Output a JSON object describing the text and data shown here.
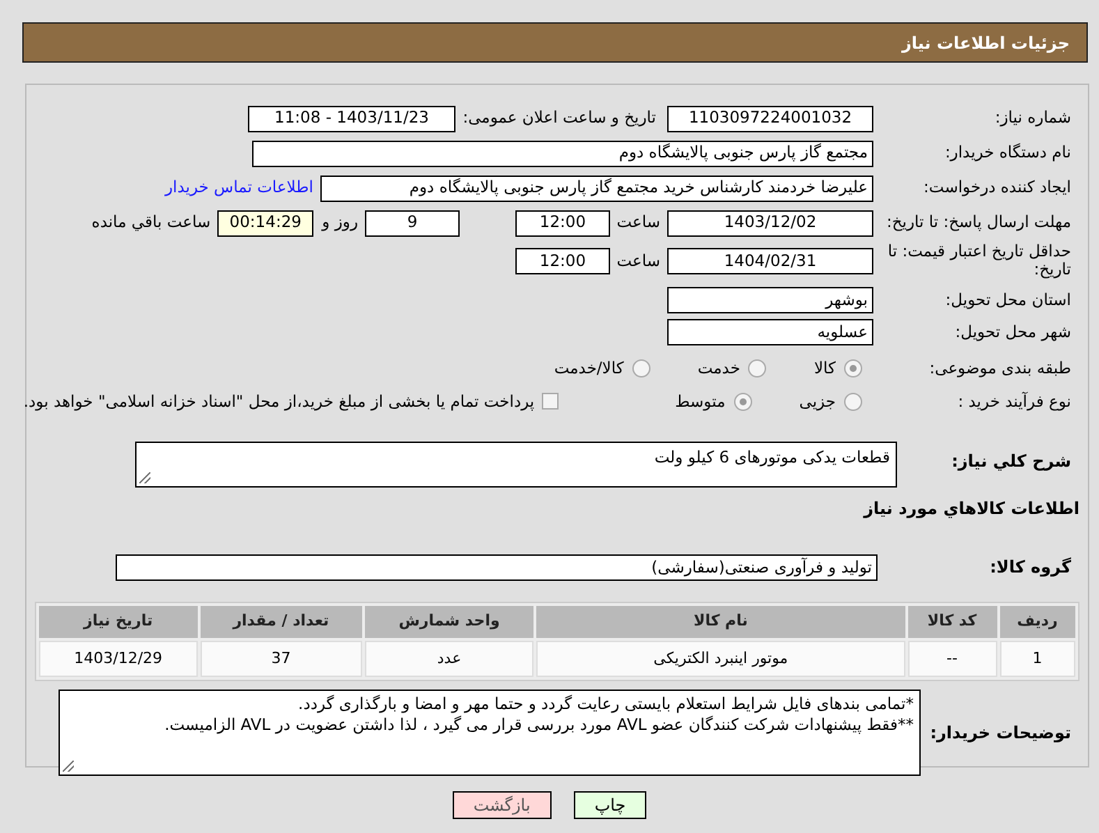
{
  "header": {
    "title": "جزئیات اطلاعات نیاز"
  },
  "need_number": {
    "label": "شماره نیاز:",
    "value": "1103097224001032"
  },
  "announce": {
    "label": "تاریخ و ساعت اعلان عمومی:",
    "value": "1403/11/23 - 11:08"
  },
  "buyer_org": {
    "label": "نام دستگاه خریدار:",
    "value": "مجتمع گاز پارس جنوبی  پالایشگاه دوم"
  },
  "requester": {
    "label": "ایجاد کننده درخواست:",
    "value": "علیرضا خردمند کارشناس خرید مجتمع گاز پارس جنوبی  پالایشگاه دوم",
    "link": "اطلاعات تماس خریدار"
  },
  "deadline": {
    "label": "مهلت ارسال پاسخ: تا تاریخ:",
    "date": "1403/12/02",
    "time_label": "ساعت",
    "time": "12:00",
    "days": "9",
    "days_label": "روز و",
    "remaining": "00:14:29",
    "remaining_label": "ساعت باقي مانده"
  },
  "validity": {
    "label": "حداقل تاریخ اعتبار قیمت: تا تاریخ:",
    "date": "1404/02/31",
    "time_label": "ساعت",
    "time": "12:00"
  },
  "province": {
    "label": "استان محل تحویل:",
    "value": "بوشهر"
  },
  "city": {
    "label": "شهر محل تحویل:",
    "value": "عسلویه"
  },
  "category": {
    "label": "طبقه بندی موضوعی:",
    "options": [
      {
        "label": "كالا",
        "selected": true
      },
      {
        "label": "خدمت",
        "selected": false
      },
      {
        "label": "كالا/خدمت",
        "selected": false
      }
    ]
  },
  "process": {
    "label": "نوع فرآیند خرید :",
    "options": [
      {
        "label": "جزیی",
        "selected": false
      },
      {
        "label": "متوسط",
        "selected": true
      }
    ],
    "payment": {
      "checked": false,
      "label": "پرداخت تمام یا بخشی از مبلغ خرید،از محل \"اسناد خزانه اسلامی\" خواهد بود."
    }
  },
  "description": {
    "label": "شرح کلي نياز:",
    "value": "قطعات یدکی موتورهای 6 کیلو ولت"
  },
  "goods_title": "اطلاعات كالاهاي مورد نياز",
  "goods_group": {
    "label": "گروه کالا:",
    "value": "تولید و فرآوری صنعتی(سفارشی)"
  },
  "table": {
    "columns": [
      "رديف",
      "کد کالا",
      "نام کالا",
      "واحد شمارش",
      "تعداد / مقدار",
      "تاریخ نیاز"
    ],
    "rows": [
      [
        "1",
        "--",
        "موتور اینبرد الکتریکی",
        "عدد",
        "37",
        "1403/12/29"
      ]
    ]
  },
  "buyer_notes": {
    "label": "توضیحات خریدار:",
    "lines": [
      "*تمامی بندهای فایل شرایط استعلام بایستی رعایت گردد و حتما مهر و امضا و بارگذاری گردد.",
      "**فقط پیشنهادات شرکت کنندگان عضو AVL مورد بررسی قرار می گیرد ، لذا داشتن عضویت در AVL الزامیست."
    ]
  },
  "buttons": [
    {
      "kind": "print",
      "label": "چاپ"
    },
    {
      "kind": "back",
      "label": "بازگشت"
    }
  ]
}
